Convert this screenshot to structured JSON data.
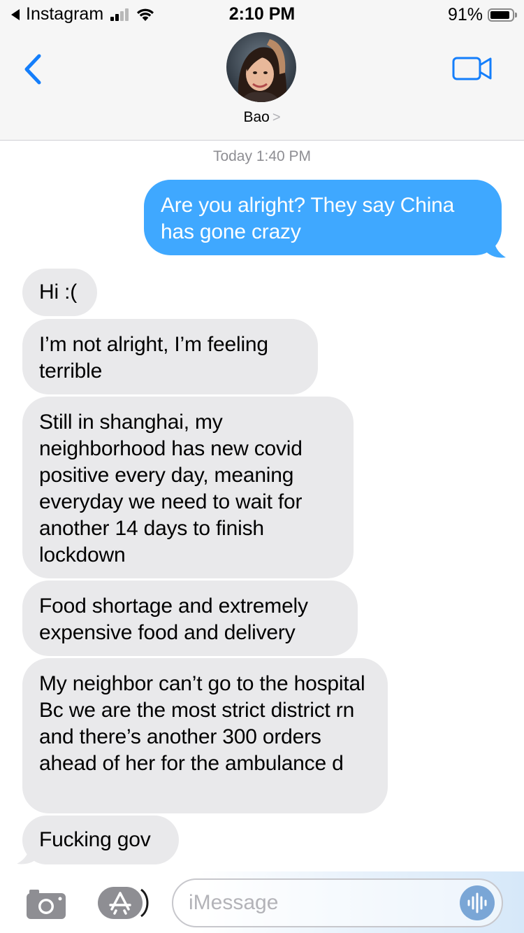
{
  "status_bar": {
    "back_app_label": "Instagram",
    "time": "2:10 PM",
    "battery_percent": "91%",
    "battery_level": 0.91,
    "signal_bars_active": 2,
    "signal_bars_total": 4
  },
  "header": {
    "contact_name": "Bao",
    "name_chevron": ">",
    "back_icon": "chevron-left-icon",
    "video_icon": "video-camera-icon"
  },
  "thread": {
    "timestamp": "Today 1:40 PM",
    "messages": [
      {
        "direction": "outgoing",
        "text": "Are you alright? They say China has gone crazy"
      },
      {
        "direction": "incoming",
        "text": "Hi :("
      },
      {
        "direction": "incoming",
        "text": "I’m not alright, I’m feeling terrible"
      },
      {
        "direction": "incoming",
        "text": "Still in shanghai, my neighborhood has new covid positive every day, meaning everyday we need to wait for another 14 days to finish lockdown"
      },
      {
        "direction": "incoming",
        "text": "Food shortage and extremely expensive food and delivery"
      },
      {
        "direction": "incoming",
        "text": "My neighbor can’t go to the hospital Bc we are the most strict district rn and there’s another 300 orders ahead of her for the ambulance d"
      },
      {
        "direction": "incoming",
        "text": "Fucking gov"
      }
    ]
  },
  "input_bar": {
    "placeholder": "iMessage",
    "camera_icon": "camera-icon",
    "apps_icon": "app-store-icon",
    "audio_icon": "audio-waveform-icon"
  },
  "colors": {
    "outgoing_bubble": "#3fa8ff",
    "incoming_bubble": "#e9e9eb",
    "accent": "#147efb",
    "header_bg": "#f6f6f6"
  }
}
